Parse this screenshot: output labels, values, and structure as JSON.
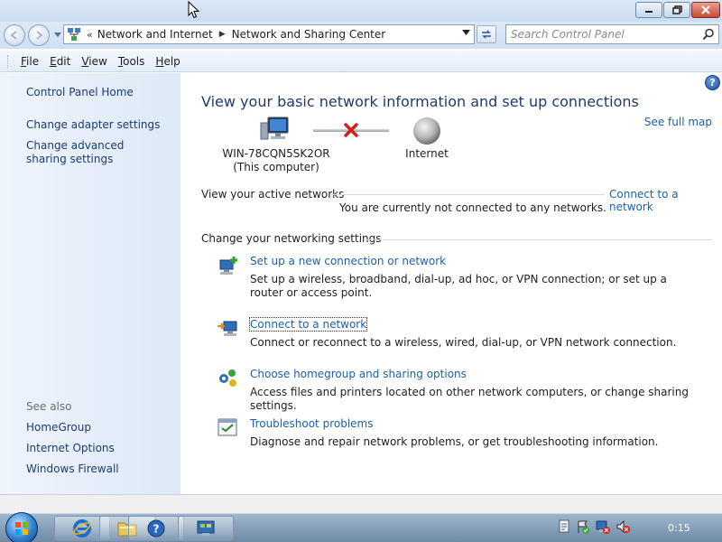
{
  "address": {
    "overflow_marker": "«",
    "crumbs": [
      "Network and Internet",
      "Network and Sharing Center"
    ]
  },
  "search": {
    "placeholder": "Search Control Panel"
  },
  "menu": [
    {
      "label": "File",
      "accel": "F"
    },
    {
      "label": "Edit",
      "accel": "E"
    },
    {
      "label": "View",
      "accel": "V"
    },
    {
      "label": "Tools",
      "accel": "T"
    },
    {
      "label": "Help",
      "accel": "H"
    }
  ],
  "sidebar": {
    "home": "Control Panel Home",
    "tasks": [
      "Change adapter settings",
      "Change advanced sharing settings"
    ],
    "see_also_title": "See also",
    "see_also": [
      "HomeGroup",
      "Internet Options",
      "Windows Firewall"
    ]
  },
  "main": {
    "headline": "View your basic network information and set up connections",
    "see_full_map": "See full map",
    "computer_name": "WIN-78CQN5SK2OR",
    "computer_caption": "(This computer)",
    "internet_label": "Internet",
    "active_networks_title": "View your active networks",
    "connect_link": "Connect to a network",
    "not_connected": "You are currently not connected to any networks.",
    "change_settings_title": "Change your networking settings",
    "tasks": [
      {
        "icon": "new-connection-icon",
        "link": "Set up a new connection or network",
        "desc": "Set up a wireless, broadband, dial-up, ad hoc, or VPN connection; or set up a router or access point."
      },
      {
        "icon": "connect-network-icon",
        "link": "Connect to a network",
        "desc": "Connect or reconnect to a wireless, wired, dial-up, or VPN network connection."
      },
      {
        "icon": "homegroup-icon",
        "link": "Choose homegroup and sharing options",
        "desc": "Access files and printers located on other network computers, or change sharing settings."
      },
      {
        "icon": "troubleshoot-icon",
        "link": "Troubleshoot problems",
        "desc": "Diagnose and repair network problems, or get troubleshooting information."
      }
    ]
  },
  "taskbar": {
    "clock": "0:15"
  },
  "colors": {
    "link": "#1f5fa8",
    "sidebar_link": "#1e3a6e",
    "error_x": "#d1211b"
  }
}
